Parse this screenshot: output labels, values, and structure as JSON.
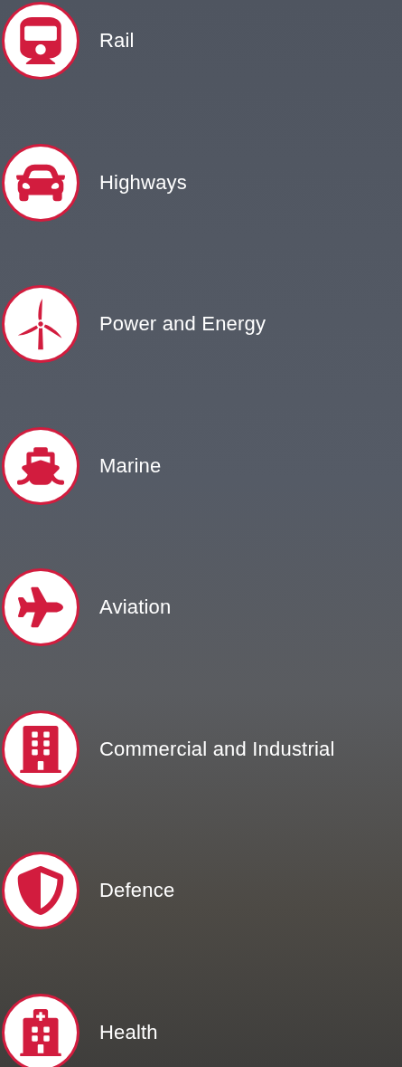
{
  "sectors": [
    {
      "label": "Rail"
    },
    {
      "label": "Highways"
    },
    {
      "label": "Power and Energy"
    },
    {
      "label": "Marine"
    },
    {
      "label": "Aviation"
    },
    {
      "label": "Commercial and Industrial"
    },
    {
      "label": "Defence"
    },
    {
      "label": "Health"
    }
  ]
}
